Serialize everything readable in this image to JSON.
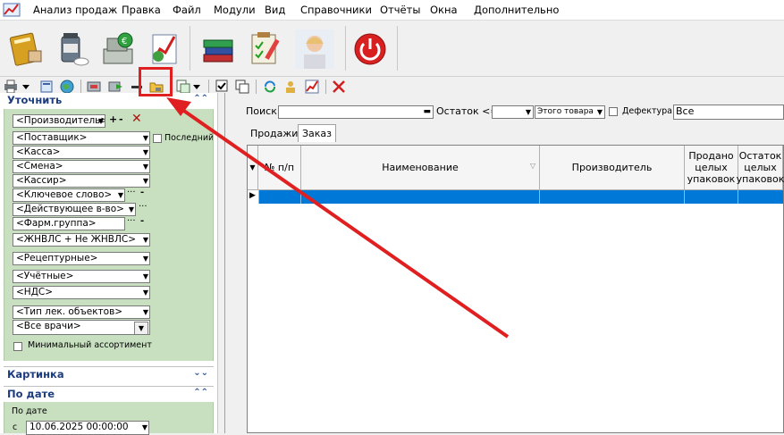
{
  "menu": {
    "items": [
      "Анализ продаж",
      "Правка",
      "Файл",
      "Модули",
      "Вид",
      "Справочники",
      "Отчёты",
      "Окна",
      "Дополнительно"
    ]
  },
  "toolbar_big": {
    "icons": [
      "journal-icon",
      "pills-icon",
      "cash-register-icon",
      "sales-chart-icon",
      "books-icon",
      "checklist-icon",
      "support-operator-icon",
      "power-icon"
    ]
  },
  "toolbar_small": {
    "icons": [
      "print-icon",
      "dropdown-icon",
      "export-icon",
      "globe-icon",
      "import-icon",
      "forward-icon",
      "minus-icon",
      "order-folder-icon",
      "copy-icon",
      "dropdown-icon",
      "checklist-icon",
      "copy-window-icon",
      "refresh-icon",
      "user-settings-icon",
      "chart-icon",
      "delete-icon"
    ]
  },
  "left_panel": {
    "refine": {
      "title": "Уточнить",
      "filters": [
        "<Производитель>",
        "<Поставщик>",
        "<Касса>",
        "<Смена>",
        "<Кассир>",
        "<Ключевое слово>",
        "<Действующее в-во>",
        "<Фарм.группа>",
        "<ЖНВЛС + Не ЖНВЛС>",
        "<Рецептурные>",
        "<Учётные>",
        "<НДС>",
        "<Тип лек. объектов>",
        "<Все врачи>"
      ],
      "last_label": "Последний г",
      "min_assortment": "Минимальный ассортимент"
    },
    "picture": {
      "title": "Картинка"
    },
    "by_date": {
      "title": "По дате",
      "sub_label": "По дате",
      "from_label": "с",
      "from_value": "10.06.2025 00:00:00"
    }
  },
  "search": {
    "label": "Поиск:",
    "value": "",
    "remain_label": "Остаток <=",
    "remain_value": "",
    "goods_value": "Этого товара",
    "defect_label": "Дефектура",
    "all_value": "Все"
  },
  "tabs": [
    "Продажи",
    "Заказ"
  ],
  "active_tab": "Заказ",
  "grid": {
    "columns": [
      "№ п/п",
      "Наименование",
      "Производитель",
      "Продано целых упаковок",
      "Остаток целых упаковок"
    ]
  },
  "colors": {
    "accent": "#1c3c80",
    "panel_green": "#c8e0c0",
    "selection": "#0078d7",
    "annotation_red": "#e02020"
  }
}
